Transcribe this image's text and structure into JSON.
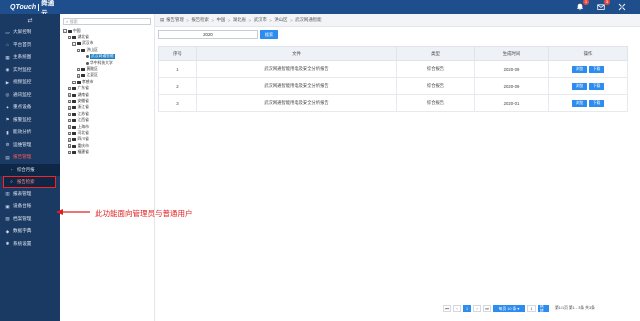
{
  "app": {
    "logo_en": "QTouch",
    "logo_cn": "舜通云",
    "notifications": {
      "bell_count": "1",
      "mail_count": "3"
    },
    "accent_color": "#1e4f8c"
  },
  "sidebar": {
    "items": [
      {
        "label": "大屏控制",
        "icon": "monitor-icon",
        "glyph": "▭"
      },
      {
        "label": "平台首页",
        "icon": "home-icon",
        "glyph": "⌂"
      },
      {
        "label": "主系统图",
        "icon": "grid-icon",
        "glyph": "▦"
      },
      {
        "label": "实时监控",
        "icon": "camera-icon",
        "glyph": "◉"
      },
      {
        "label": "视频监控",
        "icon": "video-icon",
        "glyph": "▶"
      },
      {
        "label": "通讯监控",
        "icon": "signal-icon",
        "glyph": "◎"
      },
      {
        "label": "重点设备",
        "icon": "star-icon",
        "glyph": "✦"
      },
      {
        "label": "报警监控",
        "icon": "alarm-icon",
        "glyph": "⚑"
      },
      {
        "label": "能效分析",
        "icon": "bar-chart-icon",
        "glyph": "▮"
      },
      {
        "label": "运维管理",
        "icon": "wrench-icon",
        "glyph": "⚙"
      },
      {
        "label": "报告管理",
        "icon": "report-icon",
        "glyph": "▤",
        "active": true
      }
    ],
    "sub_items": [
      {
        "label": "综合月报",
        "icon": "doc-icon",
        "glyph": "▫"
      },
      {
        "label": "报告检索",
        "icon": "search-icon",
        "glyph": "⌕",
        "highlight": true
      }
    ],
    "items_after": [
      {
        "label": "报表管理",
        "icon": "table-icon",
        "glyph": "▥"
      },
      {
        "label": "设备台账",
        "icon": "ledger-icon",
        "glyph": "▣"
      },
      {
        "label": "档案管理",
        "icon": "archive-icon",
        "glyph": "▧"
      },
      {
        "label": "数据字典",
        "icon": "dictionary-icon",
        "glyph": "◆"
      },
      {
        "label": "系统设置",
        "icon": "settings-icon",
        "glyph": "✱"
      }
    ]
  },
  "tree": {
    "search_placeholder": "搜索",
    "nodes": [
      {
        "label": "中国",
        "toggle": "−",
        "type": "folder",
        "depth": 0
      },
      {
        "label": "湖北省",
        "toggle": "−",
        "type": "folder",
        "depth": 1
      },
      {
        "label": "武汉市",
        "toggle": "−",
        "type": "folder",
        "depth": 2
      },
      {
        "label": "洪山区",
        "toggle": "−",
        "type": "folder",
        "depth": 3
      },
      {
        "label": "武汉网通智能",
        "toggle": "",
        "type": "leaf",
        "depth": 4,
        "selected": true
      },
      {
        "label": "华中科技大学",
        "toggle": "",
        "type": "leaf",
        "depth": 4
      },
      {
        "label": "黄陂区",
        "toggle": "+",
        "type": "folder",
        "depth": 3
      },
      {
        "label": "江夏区",
        "toggle": "+",
        "type": "folder",
        "depth": 3
      },
      {
        "label": "孝感市",
        "toggle": "+",
        "type": "folder",
        "depth": 2
      },
      {
        "label": "广东省",
        "toggle": "+",
        "type": "folder",
        "depth": 1
      },
      {
        "label": "湖南省",
        "toggle": "+",
        "type": "folder",
        "depth": 1
      },
      {
        "label": "安徽省",
        "toggle": "+",
        "type": "folder",
        "depth": 1
      },
      {
        "label": "浙江省",
        "toggle": "+",
        "type": "folder",
        "depth": 1
      },
      {
        "label": "江苏省",
        "toggle": "+",
        "type": "folder",
        "depth": 1
      },
      {
        "label": "江西省",
        "toggle": "+",
        "type": "folder",
        "depth": 1
      },
      {
        "label": "上海市",
        "toggle": "+",
        "type": "folder",
        "depth": 1
      },
      {
        "label": "河北省",
        "toggle": "+",
        "type": "folder",
        "depth": 1
      },
      {
        "label": "四川省",
        "toggle": "+",
        "type": "folder",
        "depth": 1
      },
      {
        "label": "重庆市",
        "toggle": "+",
        "type": "folder",
        "depth": 1
      },
      {
        "label": "福建省",
        "toggle": "+",
        "type": "folder",
        "depth": 1
      }
    ]
  },
  "breadcrumb": [
    "报告管理",
    "报告检索",
    "中国",
    "湖北省",
    "武汉市",
    "洪山区",
    "武汉网通智能"
  ],
  "filter": {
    "year_value": "2020",
    "query_label": "搜索"
  },
  "table": {
    "columns": [
      "序号",
      "文件",
      "类型",
      "生成时间",
      "操作"
    ],
    "rows": [
      {
        "index": "1",
        "file": "武汉网通智能用电及安全分析报告",
        "type": "综合报告",
        "time": "2020-09"
      },
      {
        "index": "2",
        "file": "武汉网通智能用电及安全分析报告",
        "type": "综合报告",
        "time": "2020-09"
      },
      {
        "index": "3",
        "file": "武汉网通智能用电及安全分析报告",
        "type": "综合报告",
        "time": "2020-01"
      }
    ],
    "action_view": "浏览",
    "action_download": "下载"
  },
  "pager": {
    "first": "⏮",
    "prev": "‹",
    "current": "1",
    "next": "›",
    "last": "⏭",
    "page_size": "每页 10 条 ▾",
    "goto_value": "1",
    "goto_label": "跳转",
    "info": "第1/1页 第1 - 3条 共3条"
  },
  "annotation": {
    "text": "此功能面向管理员与普通用户",
    "color": "#e02020"
  }
}
